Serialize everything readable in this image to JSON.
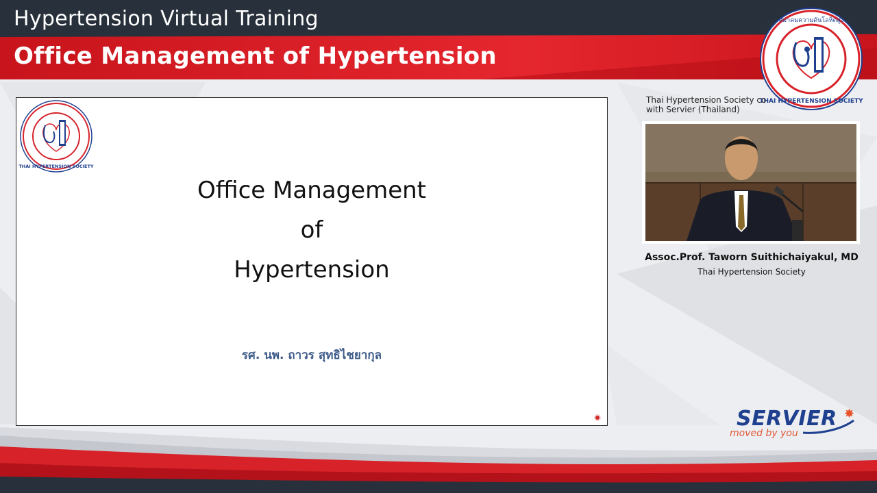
{
  "header": {
    "top_title": "Hypertension Virtual Training",
    "sub_title": "Office Management of Hypertension"
  },
  "logo": {
    "thai_text": "สมาคมความดันโลหิตสูงแห่งประเทศไทย",
    "english_text": "THAI HYPERTENSION SOCIETY"
  },
  "slide": {
    "title_line1": "Office Management",
    "title_line2": "of",
    "title_line3": "Hypertension",
    "author": "รศ. นพ. ถาวร สุทธิไชยากุล"
  },
  "side_panel": {
    "credit_line1": "Thai Hypertension Society co",
    "credit_line2": "with Servier (Thailand)",
    "speaker_name": "Assoc.Prof. Taworn Suithichaiyakul, MD",
    "speaker_org": "Thai Hypertension Society"
  },
  "sponsor": {
    "name": "SERVIER",
    "tagline": "moved by you"
  },
  "colors": {
    "header_dark": "#27303b",
    "brand_red": "#d8222a",
    "servier_blue": "#1f3f8f",
    "servier_orange": "#e8532a"
  },
  "icons": [
    "thai-hypertension-society-logo-icon",
    "servier-star-icon"
  ]
}
